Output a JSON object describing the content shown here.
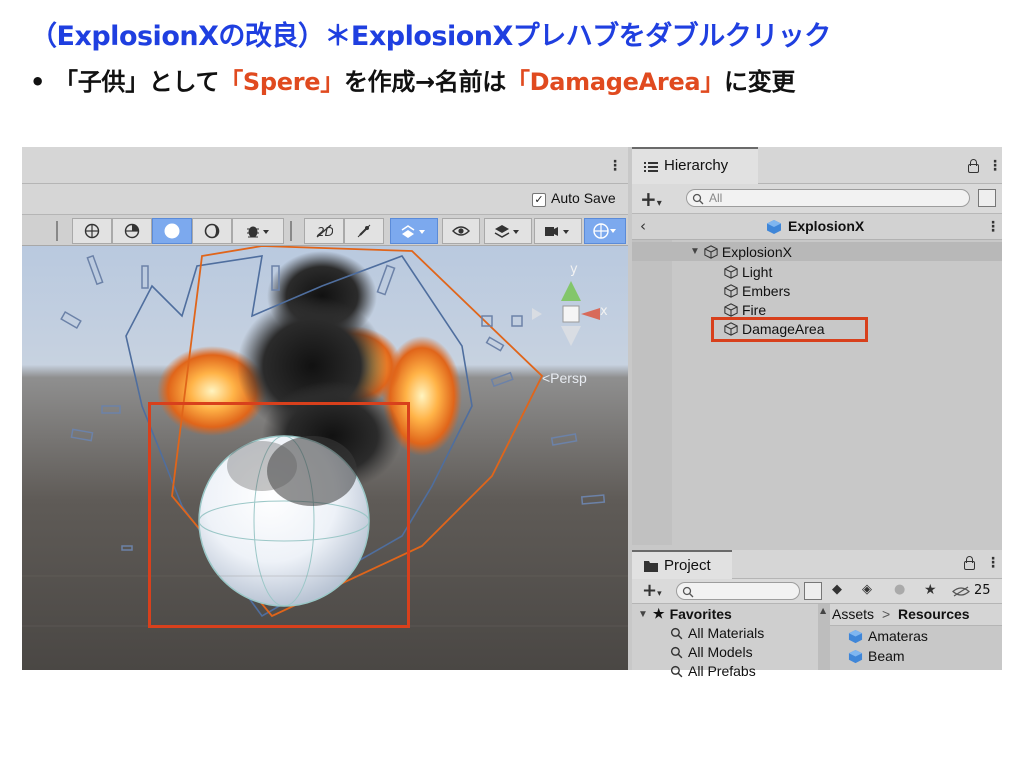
{
  "slide": {
    "title": "（ExplosionXの改良）＊ExplosionXプレハブをダブルクリック",
    "bullet": {
      "marker": "•",
      "part1": "「子供」として",
      "highlight1": "「Spere」",
      "part2": "を作成→名前は",
      "highlight2": "「DamageArea」",
      "part3": "に変更"
    }
  },
  "colors": {
    "title": "#1f3fe0",
    "highlight": "#e04a1f",
    "annotation_box": "#d8401c",
    "active_button": "#7ca9ee"
  },
  "scene": {
    "autosave_label": "Auto Save",
    "autosave_checked": true,
    "persp_label": "<Persp",
    "axes": {
      "x": "x",
      "y": "y"
    },
    "toolbar_icons": [
      "global-icon",
      "pivot-icon",
      "shaded-sphere-icon",
      "wireframe-sphere-icon",
      "bug-icon",
      "2d-toggle-icon",
      "lighting-icon",
      "effects-icon",
      "visibility-icon",
      "layers-icon",
      "camera-icon",
      "gizmos-icon"
    ]
  },
  "hierarchy": {
    "tab_label": "Hierarchy",
    "search_placeholder": "All",
    "header_title": "ExplosionX",
    "root": "ExplosionX",
    "children": [
      "Light",
      "Embers",
      "Fire",
      "DamageArea"
    ]
  },
  "project": {
    "tab_label": "Project",
    "favorites_label": "Favorites",
    "favorites": [
      "All Materials",
      "All Models",
      "All Prefabs"
    ],
    "breadcrumb_root": "Assets",
    "breadcrumb_sep": ">",
    "breadcrumb_current": "Resources",
    "assets": [
      "Amateras",
      "Beam"
    ],
    "hidden_count": "25"
  }
}
